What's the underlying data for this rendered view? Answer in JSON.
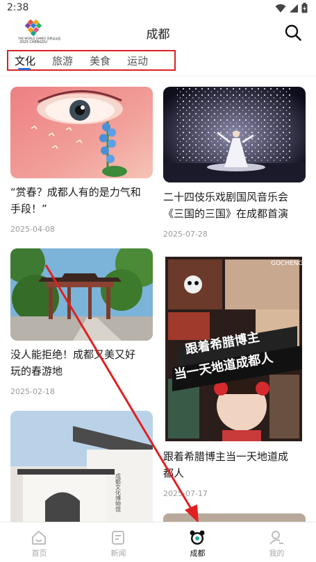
{
  "status": {
    "time": "2:38"
  },
  "header": {
    "title": "成都",
    "logo_caption_1": "THE WORLD GAMES 世界运动会",
    "logo_caption_2": "2025 CHENGDU"
  },
  "tabs": [
    {
      "label": "文化",
      "active": true
    },
    {
      "label": "旅游",
      "active": false
    },
    {
      "label": "美食",
      "active": false
    },
    {
      "label": "运动",
      "active": false
    }
  ],
  "cards": [
    {
      "title_line1": "“赏春？成都人有的是力气和",
      "title_line2": "手段！”",
      "date": "2025-04-08"
    },
    {
      "title_line1": "二十四伎乐戏剧国风音乐会",
      "title_line2": "《三国的三国》在成都首演",
      "date": "2025-07-28"
    },
    {
      "title_line1": "没人能拒绝！成都又美又好",
      "title_line2": "玩的春游地",
      "date": "2025-02-18"
    },
    {
      "title_line1": "跟着希腊博主当一天地道成",
      "title_line2": "都人",
      "date": "2025-07-17",
      "poster_line1": "跟着希腊博主",
      "poster_line2": "当一天地道成都人",
      "watermark": "GOCHENGDU"
    },
    {
      "sign_text": "成都文化博物馆"
    }
  ],
  "bottom_nav": [
    {
      "label": "首页",
      "icon": "home-icon",
      "active": false
    },
    {
      "label": "新闻",
      "icon": "news-icon",
      "active": false
    },
    {
      "label": "成都",
      "icon": "panda-icon",
      "active": true
    },
    {
      "label": "我的",
      "icon": "profile-icon",
      "active": false
    }
  ],
  "colors": {
    "highlight_box": "#d92020",
    "tab_indicator": "#2e6fd8",
    "arrow": "#e02020"
  }
}
